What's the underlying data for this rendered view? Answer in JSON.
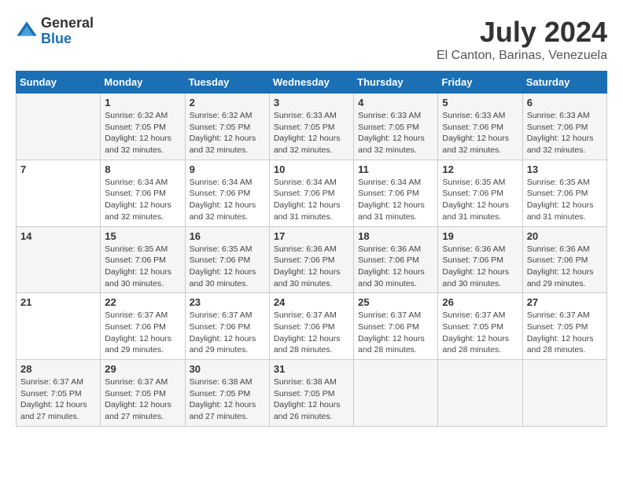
{
  "header": {
    "logo_general": "General",
    "logo_blue": "Blue",
    "month_year": "July 2024",
    "location": "El Canton, Barinas, Venezuela"
  },
  "days_of_week": [
    "Sunday",
    "Monday",
    "Tuesday",
    "Wednesday",
    "Thursday",
    "Friday",
    "Saturday"
  ],
  "weeks": [
    [
      {
        "day": "",
        "info": ""
      },
      {
        "day": "1",
        "info": "Sunrise: 6:32 AM\nSunset: 7:05 PM\nDaylight: 12 hours\nand 32 minutes."
      },
      {
        "day": "2",
        "info": "Sunrise: 6:32 AM\nSunset: 7:05 PM\nDaylight: 12 hours\nand 32 minutes."
      },
      {
        "day": "3",
        "info": "Sunrise: 6:33 AM\nSunset: 7:05 PM\nDaylight: 12 hours\nand 32 minutes."
      },
      {
        "day": "4",
        "info": "Sunrise: 6:33 AM\nSunset: 7:05 PM\nDaylight: 12 hours\nand 32 minutes."
      },
      {
        "day": "5",
        "info": "Sunrise: 6:33 AM\nSunset: 7:06 PM\nDaylight: 12 hours\nand 32 minutes."
      },
      {
        "day": "6",
        "info": "Sunrise: 6:33 AM\nSunset: 7:06 PM\nDaylight: 12 hours\nand 32 minutes."
      }
    ],
    [
      {
        "day": "7",
        "info": ""
      },
      {
        "day": "8",
        "info": "Sunrise: 6:34 AM\nSunset: 7:06 PM\nDaylight: 12 hours\nand 32 minutes."
      },
      {
        "day": "9",
        "info": "Sunrise: 6:34 AM\nSunset: 7:06 PM\nDaylight: 12 hours\nand 32 minutes."
      },
      {
        "day": "10",
        "info": "Sunrise: 6:34 AM\nSunset: 7:06 PM\nDaylight: 12 hours\nand 31 minutes."
      },
      {
        "day": "11",
        "info": "Sunrise: 6:34 AM\nSunset: 7:06 PM\nDaylight: 12 hours\nand 31 minutes."
      },
      {
        "day": "12",
        "info": "Sunrise: 6:35 AM\nSunset: 7:06 PM\nDaylight: 12 hours\nand 31 minutes."
      },
      {
        "day": "13",
        "info": "Sunrise: 6:35 AM\nSunset: 7:06 PM\nDaylight: 12 hours\nand 31 minutes."
      }
    ],
    [
      {
        "day": "14",
        "info": ""
      },
      {
        "day": "15",
        "info": "Sunrise: 6:35 AM\nSunset: 7:06 PM\nDaylight: 12 hours\nand 30 minutes."
      },
      {
        "day": "16",
        "info": "Sunrise: 6:35 AM\nSunset: 7:06 PM\nDaylight: 12 hours\nand 30 minutes."
      },
      {
        "day": "17",
        "info": "Sunrise: 6:36 AM\nSunset: 7:06 PM\nDaylight: 12 hours\nand 30 minutes."
      },
      {
        "day": "18",
        "info": "Sunrise: 6:36 AM\nSunset: 7:06 PM\nDaylight: 12 hours\nand 30 minutes."
      },
      {
        "day": "19",
        "info": "Sunrise: 6:36 AM\nSunset: 7:06 PM\nDaylight: 12 hours\nand 30 minutes."
      },
      {
        "day": "20",
        "info": "Sunrise: 6:36 AM\nSunset: 7:06 PM\nDaylight: 12 hours\nand 29 minutes."
      }
    ],
    [
      {
        "day": "21",
        "info": ""
      },
      {
        "day": "22",
        "info": "Sunrise: 6:37 AM\nSunset: 7:06 PM\nDaylight: 12 hours\nand 29 minutes."
      },
      {
        "day": "23",
        "info": "Sunrise: 6:37 AM\nSunset: 7:06 PM\nDaylight: 12 hours\nand 29 minutes."
      },
      {
        "day": "24",
        "info": "Sunrise: 6:37 AM\nSunset: 7:06 PM\nDaylight: 12 hours\nand 28 minutes."
      },
      {
        "day": "25",
        "info": "Sunrise: 6:37 AM\nSunset: 7:06 PM\nDaylight: 12 hours\nand 28 minutes."
      },
      {
        "day": "26",
        "info": "Sunrise: 6:37 AM\nSunset: 7:05 PM\nDaylight: 12 hours\nand 28 minutes."
      },
      {
        "day": "27",
        "info": "Sunrise: 6:37 AM\nSunset: 7:05 PM\nDaylight: 12 hours\nand 28 minutes."
      }
    ],
    [
      {
        "day": "28",
        "info": "Sunrise: 6:37 AM\nSunset: 7:05 PM\nDaylight: 12 hours\nand 27 minutes."
      },
      {
        "day": "29",
        "info": "Sunrise: 6:37 AM\nSunset: 7:05 PM\nDaylight: 12 hours\nand 27 minutes."
      },
      {
        "day": "30",
        "info": "Sunrise: 6:38 AM\nSunset: 7:05 PM\nDaylight: 12 hours\nand 27 minutes."
      },
      {
        "day": "31",
        "info": "Sunrise: 6:38 AM\nSunset: 7:05 PM\nDaylight: 12 hours\nand 26 minutes."
      },
      {
        "day": "",
        "info": ""
      },
      {
        "day": "",
        "info": ""
      },
      {
        "day": "",
        "info": ""
      }
    ]
  ]
}
